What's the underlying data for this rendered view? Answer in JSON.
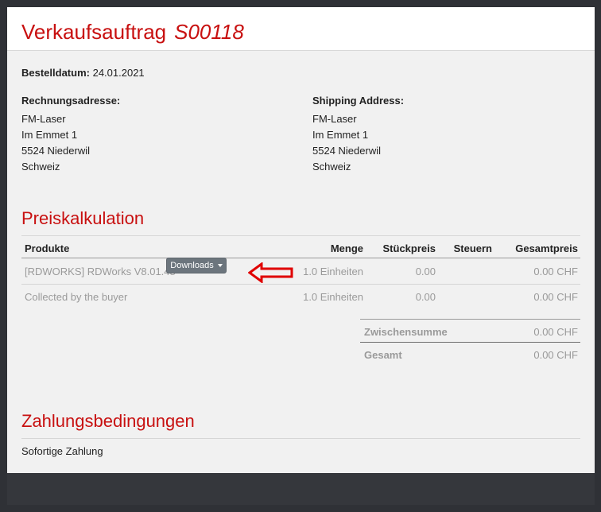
{
  "header": {
    "title": "Verkaufsauftrag",
    "reference": "S00118"
  },
  "order": {
    "date_label": "Bestelldatum:",
    "date_value": "24.01.2021",
    "billing": {
      "label": "Rechnungsadresse:",
      "lines": [
        "FM-Laser",
        "Im Emmet 1",
        "5524 Niederwil",
        "Schweiz"
      ]
    },
    "shipping": {
      "label": "Shipping Address:",
      "lines": [
        "FM-Laser",
        "Im Emmet 1",
        "5524 Niederwil",
        "Schweiz"
      ]
    }
  },
  "pricing": {
    "title": "Preiskalkulation",
    "columns": [
      "Produkte",
      "Menge",
      "Stückpreis",
      "Steuern",
      "Gesamtpreis"
    ],
    "rows": [
      {
        "product": "[RDWORKS] RDWorks V8.01.48",
        "qty": "1.0 Einheiten",
        "unit_price": "0.00",
        "taxes": "",
        "total": "0.00 CHF"
      },
      {
        "product": "Collected by the buyer",
        "qty": "1.0 Einheiten",
        "unit_price": "0.00",
        "taxes": "",
        "total": "0.00 CHF"
      }
    ],
    "downloads_label": "Downloads",
    "subtotal_label": "Zwischensumme",
    "subtotal_value": "0.00 CHF",
    "total_label": "Gesamt",
    "total_value": "0.00 CHF"
  },
  "payment": {
    "title": "Zahlungsbedingungen",
    "text": "Sofortige Zahlung"
  },
  "colors": {
    "accent": "#c81010",
    "arrow": "#e00000",
    "button": "#6c757d"
  },
  "icons": {
    "arrow": "left-arrow-icon",
    "caret": "chevron-down-icon"
  }
}
